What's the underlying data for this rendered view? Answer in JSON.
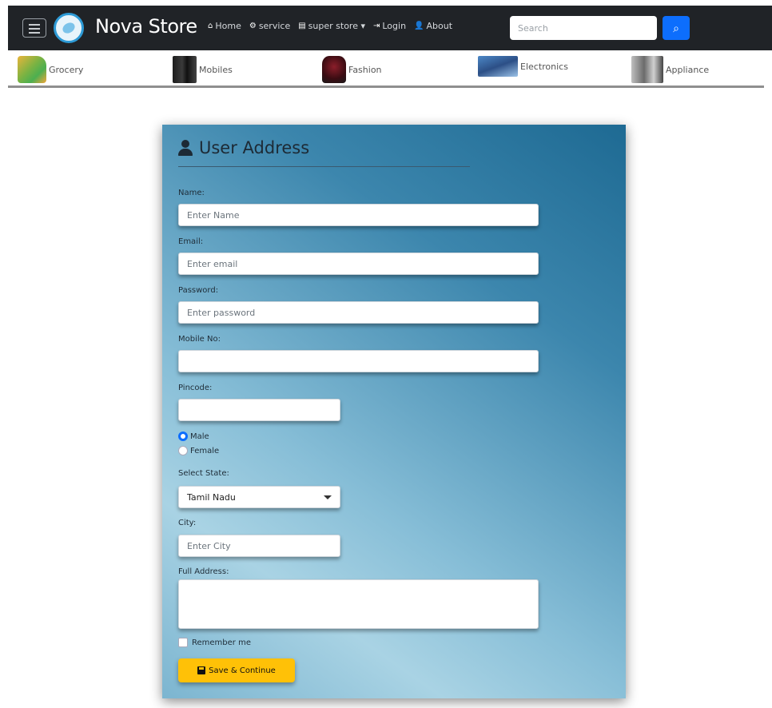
{
  "navbar": {
    "brand": "Nova Store",
    "links": [
      {
        "icon": "home-icon",
        "glyph": "⌂",
        "label": "Home"
      },
      {
        "icon": "service-icon",
        "glyph": "⚙",
        "label": "service"
      },
      {
        "icon": "store-icon",
        "glyph": "▤",
        "label": "super store ▾"
      },
      {
        "icon": "login-icon",
        "glyph": "⇥",
        "label": "Login"
      },
      {
        "icon": "user-icon",
        "glyph": "👤",
        "label": "About"
      }
    ],
    "search_placeholder": "Search",
    "search_icon": "search-icon"
  },
  "categories": [
    {
      "label": "Grocery"
    },
    {
      "label": "Mobiles"
    },
    {
      "label": "Fashion"
    },
    {
      "label": "Electronics"
    },
    {
      "label": "Appliance"
    }
  ],
  "form": {
    "title": "User Address",
    "name_label": "Name:",
    "name_placeholder": "Enter Name",
    "email_label": "Email:",
    "email_placeholder": "Enter email",
    "password_label": "Password:",
    "password_placeholder": "Enter password",
    "mobile_label": "Mobile No:",
    "pincode_label": "Pincode:",
    "gender_male": "Male",
    "gender_female": "Female",
    "gender_selected": "Male",
    "state_label": "Select State:",
    "state_value": "Tamil Nadu",
    "city_label": "City:",
    "city_placeholder": "Enter City",
    "address_label": "Full Address:",
    "remember_label": "Remember me",
    "save_label": "Save & Continue"
  },
  "colors": {
    "navbar_bg": "#202327",
    "search_button": "#0d6efd",
    "save_button": "#ffc107"
  }
}
